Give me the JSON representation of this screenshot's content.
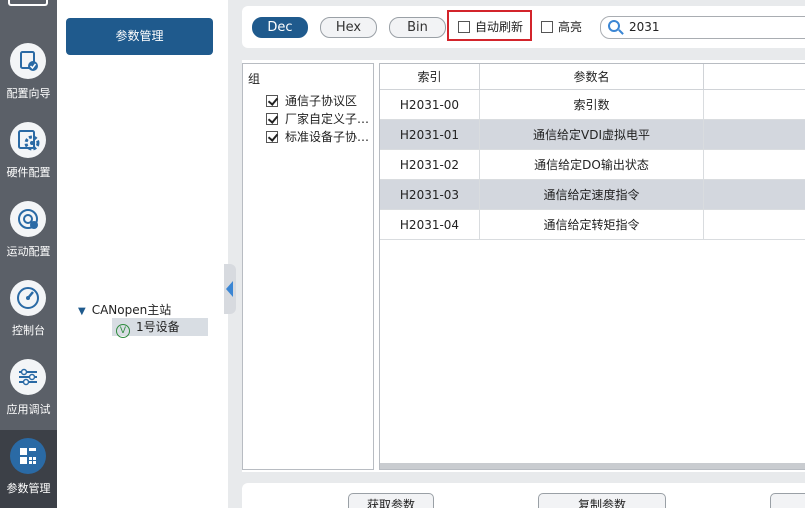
{
  "nav": {
    "items": [
      {
        "label": "配置向导",
        "icon": "wizard-icon"
      },
      {
        "label": "硬件配置",
        "icon": "hardware-gear-icon"
      },
      {
        "label": "运动配置",
        "icon": "motion-icon"
      },
      {
        "label": "控制台",
        "icon": "gauge-icon"
      },
      {
        "label": "应用调试",
        "icon": "sliders-icon"
      },
      {
        "label": "参数管理",
        "icon": "param-grid-icon",
        "active": true
      }
    ]
  },
  "sidebar": {
    "param_button": "参数管理",
    "tree": {
      "root": "CANopen主站",
      "child": "1号设备"
    }
  },
  "toolbar": {
    "dec": "Dec",
    "hex": "Hex",
    "bin": "Bin",
    "auto_refresh": "自动刷新",
    "highlight": "高亮",
    "search_value": "2031"
  },
  "groups": {
    "header": "组",
    "items": [
      "通信子协议区",
      "厂家自定义子…",
      "标准设备子协…"
    ]
  },
  "table": {
    "columns": [
      "索引",
      "参数名"
    ],
    "rows": [
      {
        "index": "H2031-00",
        "name": "索引数"
      },
      {
        "index": "H2031-01",
        "name": "通信给定VDI虚拟电平"
      },
      {
        "index": "H2031-02",
        "name": "通信给定DO输出状态"
      },
      {
        "index": "H2031-03",
        "name": "通信给定速度指令"
      },
      {
        "index": "H2031-04",
        "name": "通信给定转矩指令"
      }
    ]
  },
  "actions": {
    "fetch": "获取参数",
    "copy": "复制参数"
  },
  "colors": {
    "accent": "#1f5a8d",
    "nav_bg": "#5b6068",
    "highlight_frame": "#d3242b",
    "alt_row": "#d3d7de"
  }
}
